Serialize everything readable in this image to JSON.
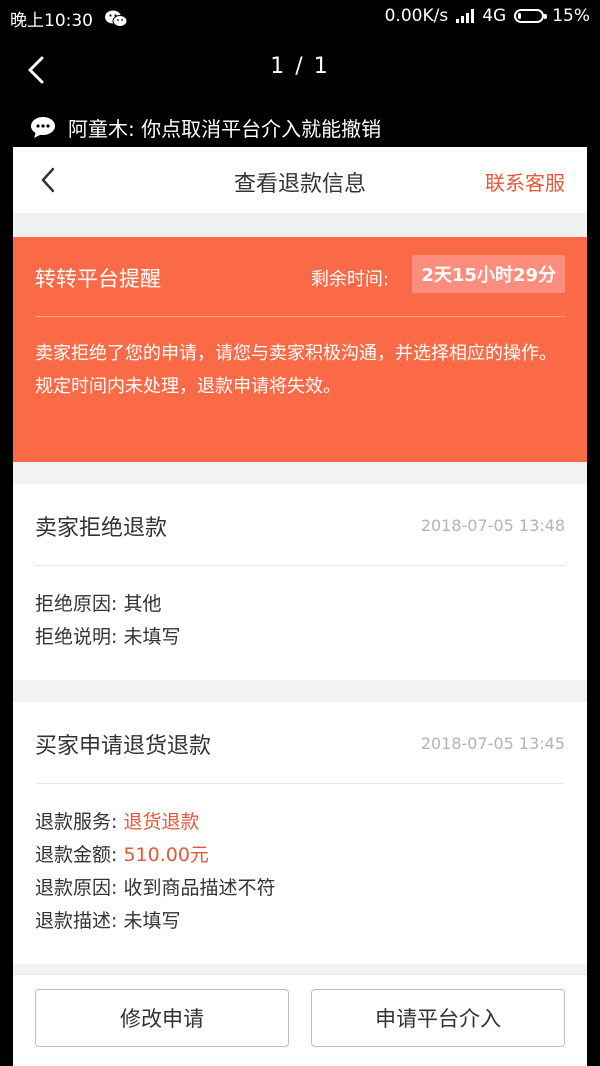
{
  "status_bar": {
    "time": "晚上10:30",
    "network_speed": "0.00K/s",
    "network_type": "4G",
    "battery_percent": "15%",
    "battery_level": 0.15
  },
  "viewer": {
    "page_indicator": "1 / 1"
  },
  "message": {
    "text": "阿童木: 你点取消平台介入就能撤销"
  },
  "nav": {
    "title": "查看退款信息",
    "contact_link": "联系客服"
  },
  "alert": {
    "title": "转转平台提醒",
    "remaining_label": "剩余时间:",
    "remaining_value": "2天15小时29分",
    "line1": "卖家拒绝了您的申请，请您与卖家积极沟通，并选择相应的操作。",
    "line2": "规定时间内未处理，退款申请将失效。"
  },
  "seller_section": {
    "title": "卖家拒绝退款",
    "time": "2018-07-05 13:48",
    "reason_label": "拒绝原因: ",
    "reason_value": "其他",
    "desc_label": "拒绝说明: ",
    "desc_value": "未填写"
  },
  "buyer_section": {
    "title": "买家申请退货退款",
    "time": "2018-07-05 13:45",
    "service_label": "退款服务: ",
    "service_value": "退货退款",
    "amount_label": "退款金额: ",
    "amount_value": "510.00元",
    "reason_label": "退款原因: ",
    "reason_value": "收到商品描述不符",
    "desc_label": "退款描述: ",
    "desc_value": "未填写"
  },
  "buttons": {
    "modify": "修改申请",
    "platform": "申请平台介入"
  },
  "colors": {
    "alert_bg": "#fb6a47",
    "accent_red": "#e35a3a"
  }
}
